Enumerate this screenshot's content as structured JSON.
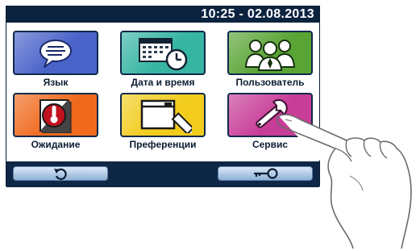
{
  "header": {
    "datetime": "10:25 - 02.08.2013"
  },
  "tiles": [
    {
      "label": "Язык",
      "icon": "speech-bubble-icon",
      "color": "#4a63c9"
    },
    {
      "label": "Дата и время",
      "icon": "calendar-clock-icon",
      "color": "#37b5a3"
    },
    {
      "label": "Пользователь",
      "icon": "users-icon",
      "color": "#5aa436"
    },
    {
      "label": "Ожидание",
      "icon": "thermometer-icon",
      "color": "#f06a1e"
    },
    {
      "label": "Преференции",
      "icon": "window-pencil-icon",
      "color": "#f2cc1d"
    },
    {
      "label": "Сервис",
      "icon": "wrench-icon",
      "color": "#c83d98"
    }
  ],
  "footer": {
    "back_icon": "back-arrow-icon",
    "key_icon": "key-icon"
  }
}
